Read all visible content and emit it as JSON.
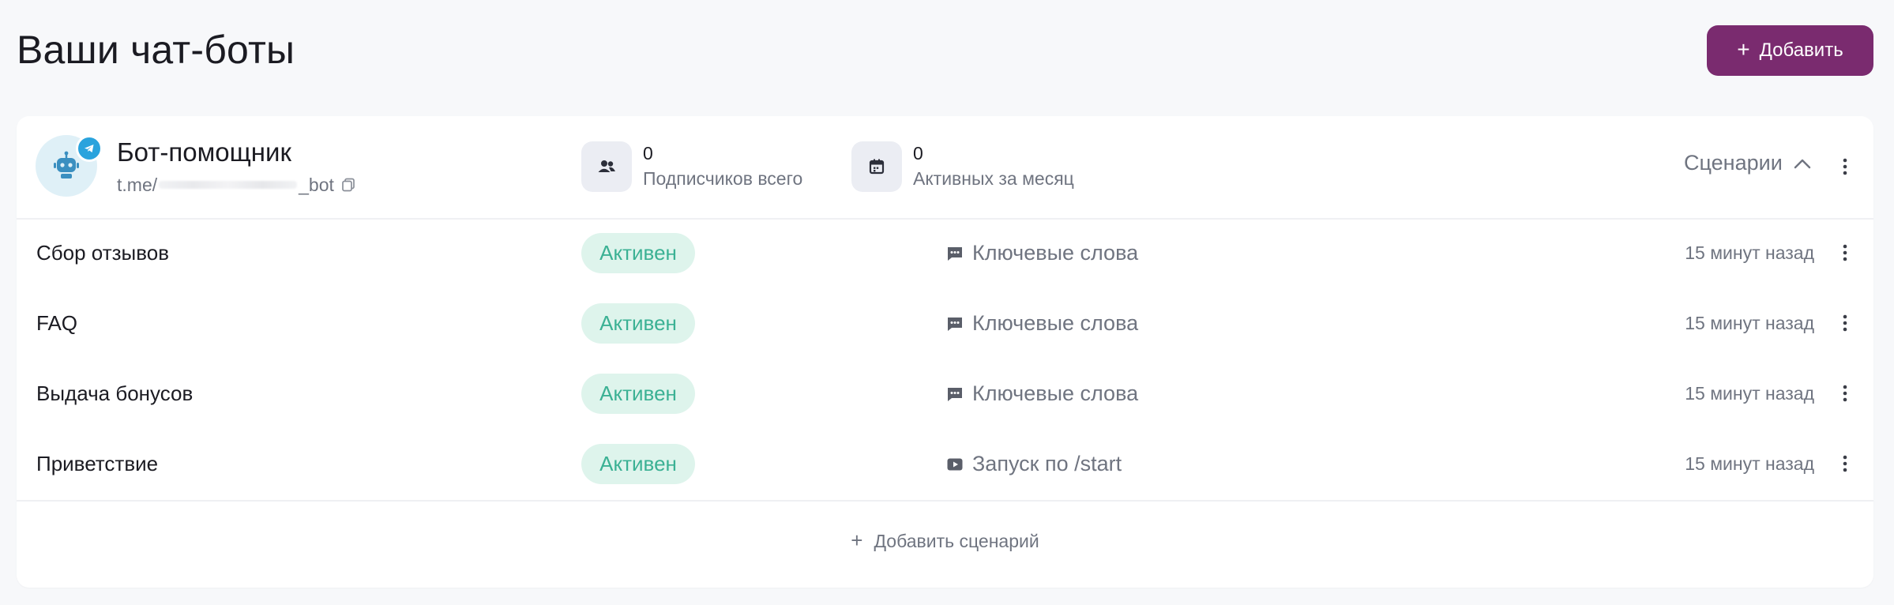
{
  "page": {
    "title": "Ваши чат-боты"
  },
  "toolbar": {
    "add_label": "Добавить"
  },
  "bot": {
    "name": "Бот-помощник",
    "link_prefix": "t.me/",
    "link_suffix": "_bot",
    "stats": [
      {
        "value": "0",
        "label": "Подписчиков всего",
        "icon": "users-icon"
      },
      {
        "value": "0",
        "label": "Активных за месяц",
        "icon": "calendar-icon"
      }
    ],
    "scenarios_label": "Сценарии"
  },
  "scenarios": [
    {
      "name": "Сбор отзывов",
      "status": "Активен",
      "trigger": "Ключевые слова",
      "trigger_icon": "message-icon",
      "time": "15 минут назад"
    },
    {
      "name": "FAQ",
      "status": "Активен",
      "trigger": "Ключевые слова",
      "trigger_icon": "message-icon",
      "time": "15 минут назад"
    },
    {
      "name": "Выдача бонусов",
      "status": "Активен",
      "trigger": "Ключевые слова",
      "trigger_icon": "message-icon",
      "time": "15 минут назад"
    },
    {
      "name": "Приветствие",
      "status": "Активен",
      "trigger": "Запуск по /start",
      "trigger_icon": "play-icon",
      "time": "15 минут назад"
    }
  ],
  "add_scenario_label": "Добавить сценарий",
  "colors": {
    "accent": "#7a2b6f",
    "status_bg": "#def4ec",
    "status_text": "#3bb194",
    "telegram": "#2aa3dd"
  }
}
